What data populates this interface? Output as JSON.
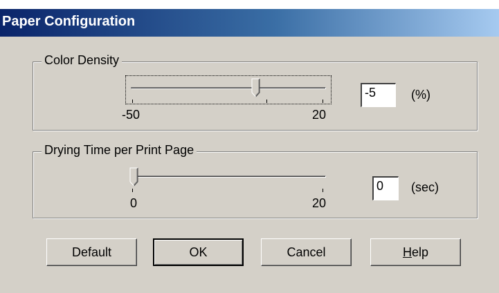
{
  "window": {
    "title": "Paper Configuration"
  },
  "color_density": {
    "label": "Color Density",
    "min_label": "-50",
    "max_label": "20",
    "value": "-5",
    "unit": "(%)"
  },
  "drying_time": {
    "label": "Drying Time per Print Page",
    "min_label": "0",
    "max_label": "20",
    "value": "0",
    "unit": "(sec)"
  },
  "buttons": {
    "default": "Default",
    "ok": "OK",
    "cancel": "Cancel",
    "help_rest": "elp",
    "help_mnemonic": "H"
  }
}
